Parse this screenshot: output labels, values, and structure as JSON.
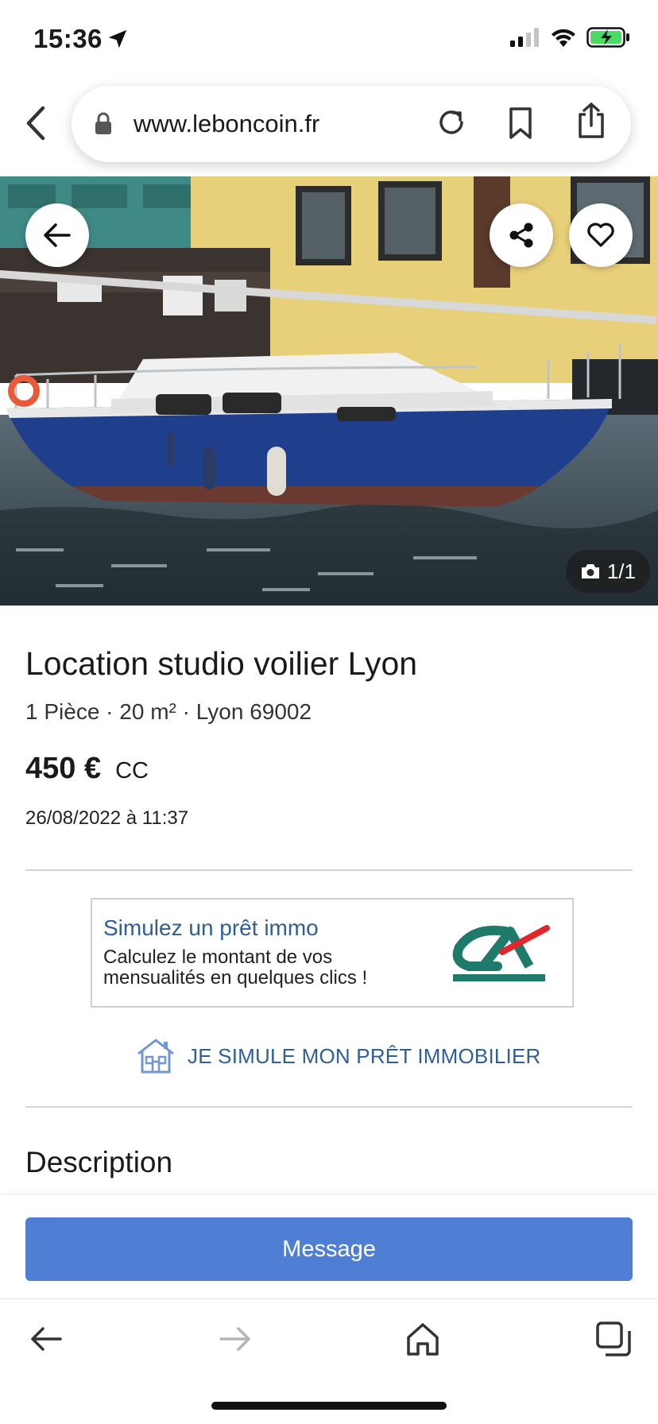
{
  "status_bar": {
    "time": "15:36",
    "icons": [
      "location-arrow-icon",
      "signal-icon",
      "wifi-icon",
      "battery-charging-icon"
    ]
  },
  "browser": {
    "url": "www.leboncoin.fr"
  },
  "photo": {
    "counter": "1/1"
  },
  "listing": {
    "title": "Location studio voilier Lyon",
    "subtitle": "1 Pièce · 20 m² · Lyon 69002",
    "price": "450 €",
    "price_suffix": "CC",
    "date": "26/08/2022 à 11:37"
  },
  "ad": {
    "title": "Simulez un prêt immo",
    "text": "Calculez le montant de vos mensualités en quelques clics !",
    "link": "JE SIMULE MON PRÊT IMMOBILIER",
    "brand_colors": {
      "teal": "#1f7a6c",
      "red": "#e3262b",
      "blue": "#2f5f98"
    }
  },
  "description": {
    "heading": "Description"
  },
  "actions": {
    "message_label": "Message",
    "accent_color": "#4f7fd4"
  }
}
